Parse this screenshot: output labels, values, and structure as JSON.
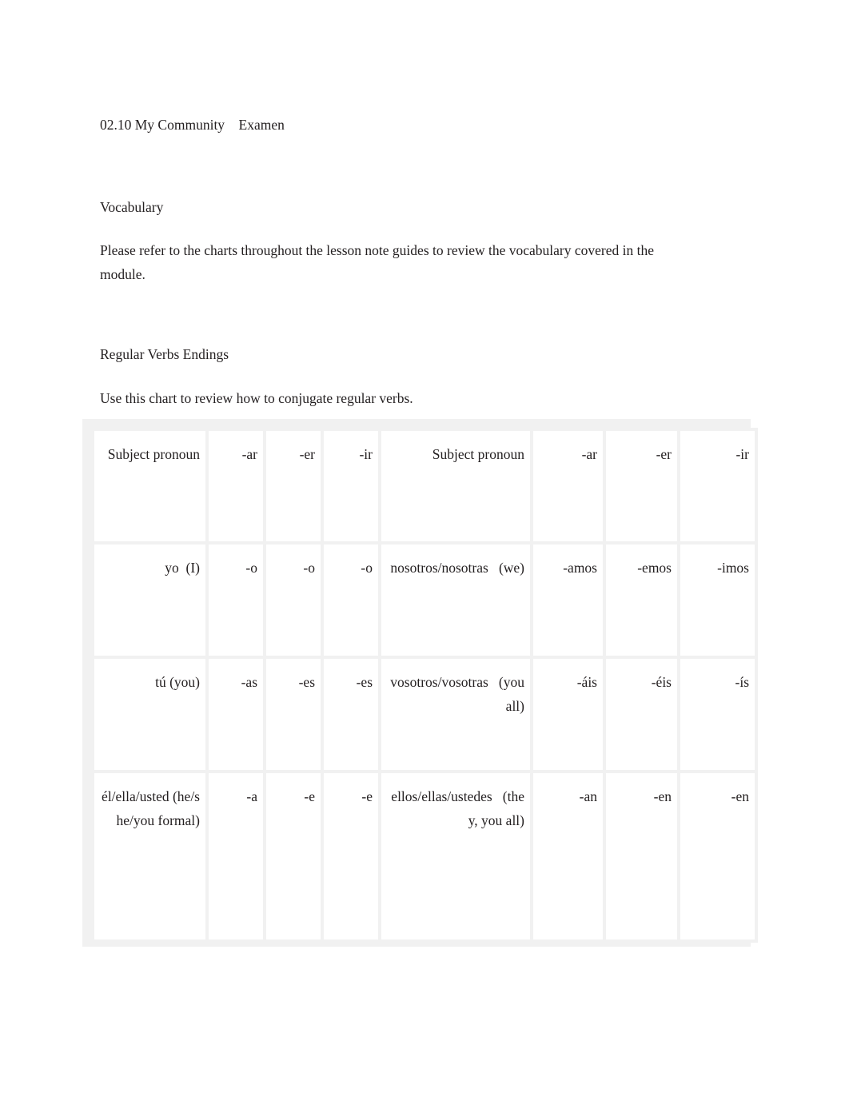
{
  "document": {
    "title": "02.10 My Community    Examen",
    "sections": {
      "vocabulary_heading": "Vocabulary",
      "vocabulary_body": "Please refer to the charts throughout the lesson note guides to review the vocabulary covered in the module.",
      "verbs_heading": "Regular Verbs Endings",
      "verbs_body": "Use this chart to review how to conjugate regular verbs."
    }
  },
  "chart_data": {
    "type": "table",
    "title": "Regular Verbs Endings",
    "columns": [
      "Subject pronoun",
      "-ar",
      "-er",
      "-ir",
      "Subject pronoun",
      "-ar",
      "-er",
      "-ir"
    ],
    "rows": [
      {
        "singular_pronoun": "yo  (I)",
        "singular_ar": "-o",
        "singular_er": "-o",
        "singular_ir": "-o",
        "plural_pronoun": "nosotros/nosotras   (we)",
        "plural_ar": "-amos",
        "plural_er": "-emos",
        "plural_ir": "-imos"
      },
      {
        "singular_pronoun": "tú (you)",
        "singular_ar": "-as",
        "singular_er": "-es",
        "singular_ir": "-es",
        "plural_pronoun": "vosotros/vosotras   (you all)",
        "plural_ar": "-áis",
        "plural_er": "-éis",
        "plural_ir": "-ís"
      },
      {
        "singular_pronoun": "él/ella/usted (he/she/you formal)",
        "singular_ar": "-a",
        "singular_er": "-e",
        "singular_ir": "-e",
        "plural_pronoun": "ellos/ellas/ustedes   (they, you all)",
        "plural_ar": "-an",
        "plural_er": "-en",
        "plural_ir": "-en"
      }
    ]
  },
  "colors": {
    "text": "#231f20",
    "page_background": "#ffffff",
    "table_gridline": "#f1f1f1",
    "cell_background": "#ffffff"
  }
}
